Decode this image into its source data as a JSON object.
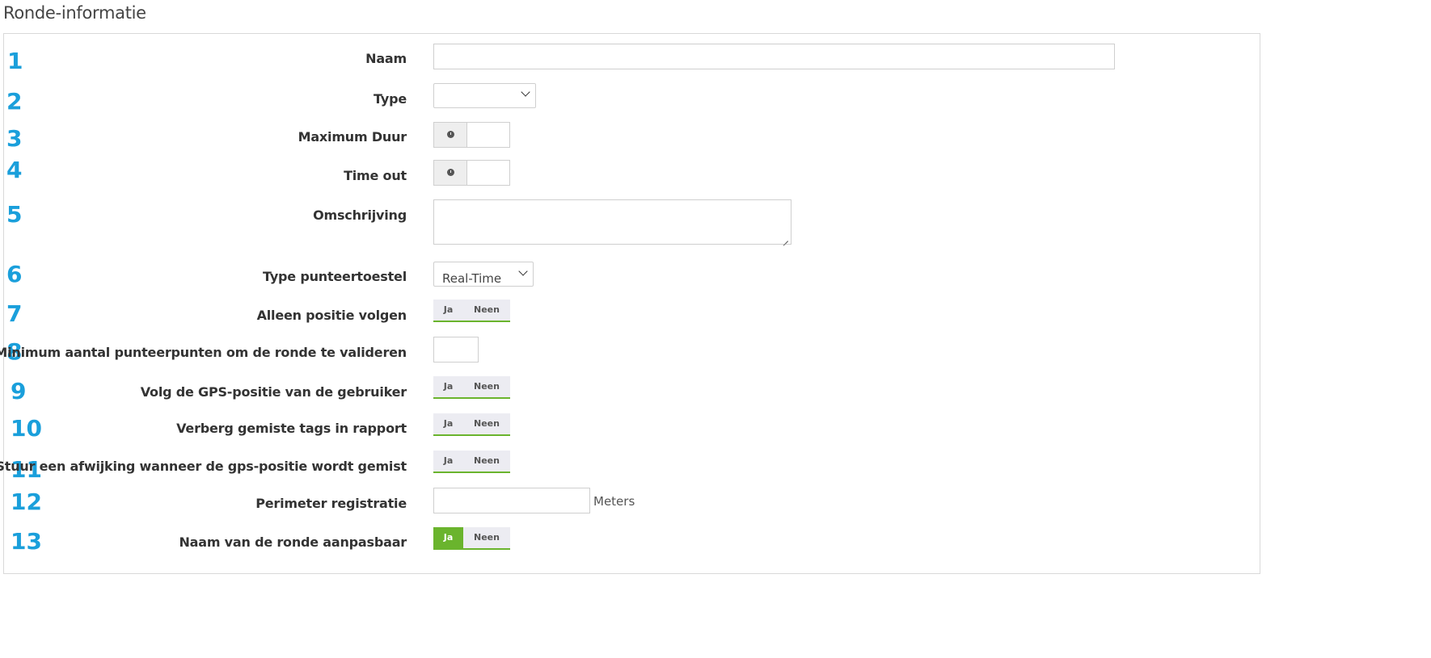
{
  "section": {
    "title": "Ronde-informatie"
  },
  "rows": [
    {
      "number": "1",
      "label": "Naam"
    },
    {
      "number": "2",
      "label": "Type"
    },
    {
      "number": "3",
      "label": "Maximum Duur"
    },
    {
      "number": "4",
      "label": "Time out"
    },
    {
      "number": "5",
      "label": "Omschrijving"
    },
    {
      "number": "6",
      "label": "Type punteertoestel"
    },
    {
      "number": "7",
      "label": "Alleen positie volgen"
    },
    {
      "number": "8",
      "label": "Minimum aantal punteerpunten om de ronde te valideren"
    },
    {
      "number": "9",
      "label": "Volg de GPS-positie van de gebruiker"
    },
    {
      "number": "10",
      "label": "Verberg gemiste tags in rapport"
    },
    {
      "number": "11",
      "label": "Stuur een afwijking wanneer de gps-positie wordt gemist"
    },
    {
      "number": "12",
      "label": "Perimeter registratie"
    },
    {
      "number": "13",
      "label": "Naam van de ronde aanpasbaar"
    }
  ],
  "fields": {
    "naam_value": "",
    "type_value": "",
    "type_punteertoestel_value": "Real-Time",
    "minimum_value": "",
    "perimeter_value": "",
    "perimeter_unit": "Meters",
    "omschrijving_value": ""
  },
  "toggle": {
    "yes_label": "Ja",
    "no_label": "Neen"
  },
  "toggle_states": {
    "alleen_positie_volgen": "none",
    "volg_gps": "none",
    "verberg_gemiste_tags": "none",
    "stuur_afwijking": "none",
    "naam_aanpasbaar": "Ja"
  },
  "icons": {
    "duration": "clock-icon",
    "select": "chevron-down-icon"
  },
  "colors": {
    "number": "#1a9fdb",
    "toggle_active": "#6ab42d"
  }
}
